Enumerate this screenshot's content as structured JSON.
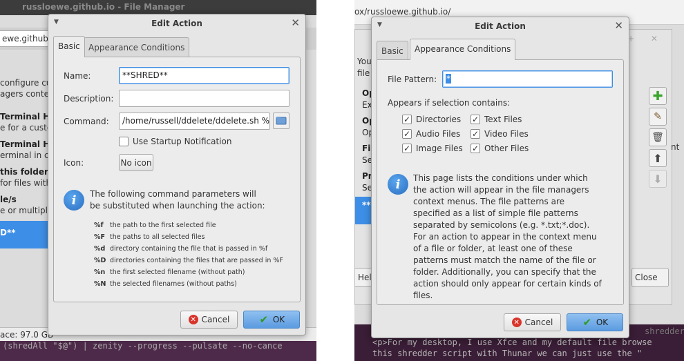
{
  "left": {
    "bg_window": {
      "title": "russloewe.github.io - File Manager",
      "path_fragment": "ewe.github.io",
      "left_text": [
        "configure cus",
        "agers contex"
      ],
      "list_items": [
        {
          "title": "Terminal He",
          "subtitle": "e for a custo"
        },
        {
          "title": "Terminal He",
          "subtitle": "erminal in co"
        },
        {
          "title": "this folder",
          "subtitle": "for files with"
        },
        {
          "title": "le/s",
          "subtitle": "e or multipl"
        },
        {
          "title": "D**",
          "subtitle": ""
        }
      ],
      "status": "ace: 97.0 GB",
      "editor_line": "(shredAll \"$@\") | zenity --progress --pulsate --no-cance"
    },
    "dialog": {
      "title": "Edit Action",
      "tabs": [
        "Basic",
        "Appearance Conditions"
      ],
      "name_label": "Name:",
      "name_value": "**SHRED**",
      "description_label": "Description:",
      "description_value": "",
      "command_label": "Command:",
      "command_value": "/home/russell/ddelete/ddelete.sh %F",
      "startup_notification_label": "Use Startup Notification",
      "icon_label": "Icon:",
      "icon_button": "No icon",
      "info_text": "The following command parameters will be substituted when launching the action:",
      "params": [
        {
          "key": "%f",
          "desc": "the path to the first selected file"
        },
        {
          "key": "%F",
          "desc": "the paths to all selected files"
        },
        {
          "key": "%d",
          "desc": "directory containing the file that is passed in %f"
        },
        {
          "key": "%D",
          "desc": "directories containing the files that are passed in %F"
        },
        {
          "key": "%n",
          "desc": "the first selected filename (without path)"
        },
        {
          "key": "%N",
          "desc": "the selected filenames (without paths)"
        }
      ],
      "cancel_label": "Cancel",
      "ok_label": "OK"
    }
  },
  "right": {
    "bg_window": {
      "path": "ox/russloewe.github.io/",
      "partial_text": [
        "You",
        "file"
      ],
      "list_items": [
        {
          "title": "Op",
          "subtitle": "Ex"
        },
        {
          "title": "Op",
          "subtitle": "Op"
        },
        {
          "title": "Fi",
          "subtitle": "Se"
        },
        {
          "title": "Pr",
          "subtitle": "Se"
        },
        {
          "title": "**",
          "subtitle": ""
        }
      ],
      "extra_text": "nt",
      "help_label": "Hel",
      "close_label": "Close",
      "editor_lines": [
        "</p>",
        "<p>For my desktop, I use Xfce and my default file browse",
        "this shredder script with Thunar we can just use the \""
      ],
      "editor_tail": "shredder.s"
    },
    "dialog": {
      "title": "Edit Action",
      "tabs": [
        "Basic",
        "Appearance Conditions"
      ],
      "file_pattern_label": "File Pattern:",
      "file_pattern_value": "*",
      "appears_label": "Appears if selection contains:",
      "checkboxes": [
        {
          "label": "Directories",
          "checked": true
        },
        {
          "label": "Text Files",
          "checked": true
        },
        {
          "label": "Audio Files",
          "checked": true
        },
        {
          "label": "Video Files",
          "checked": true
        },
        {
          "label": "Image Files",
          "checked": true
        },
        {
          "label": "Other Files",
          "checked": true
        }
      ],
      "info_text": "This page lists the conditions under which the action will appear in the file managers context menus. The file patterns are specified as a list of simple file patterns separated by semicolons (e.g. *.txt;*.doc). For an action to appear in the context menu of a file or folder, at least one of these patterns must match the name of the file or folder. Additionally, you can specify that the action should only appear for certain kinds of files.",
      "cancel_label": "Cancel",
      "ok_label": "OK"
    }
  },
  "colors": {
    "accent": "#3d8ee6",
    "cancel_red": "#d9342b",
    "ok_green": "#2e9a1e",
    "add_green": "#3aa52c"
  }
}
